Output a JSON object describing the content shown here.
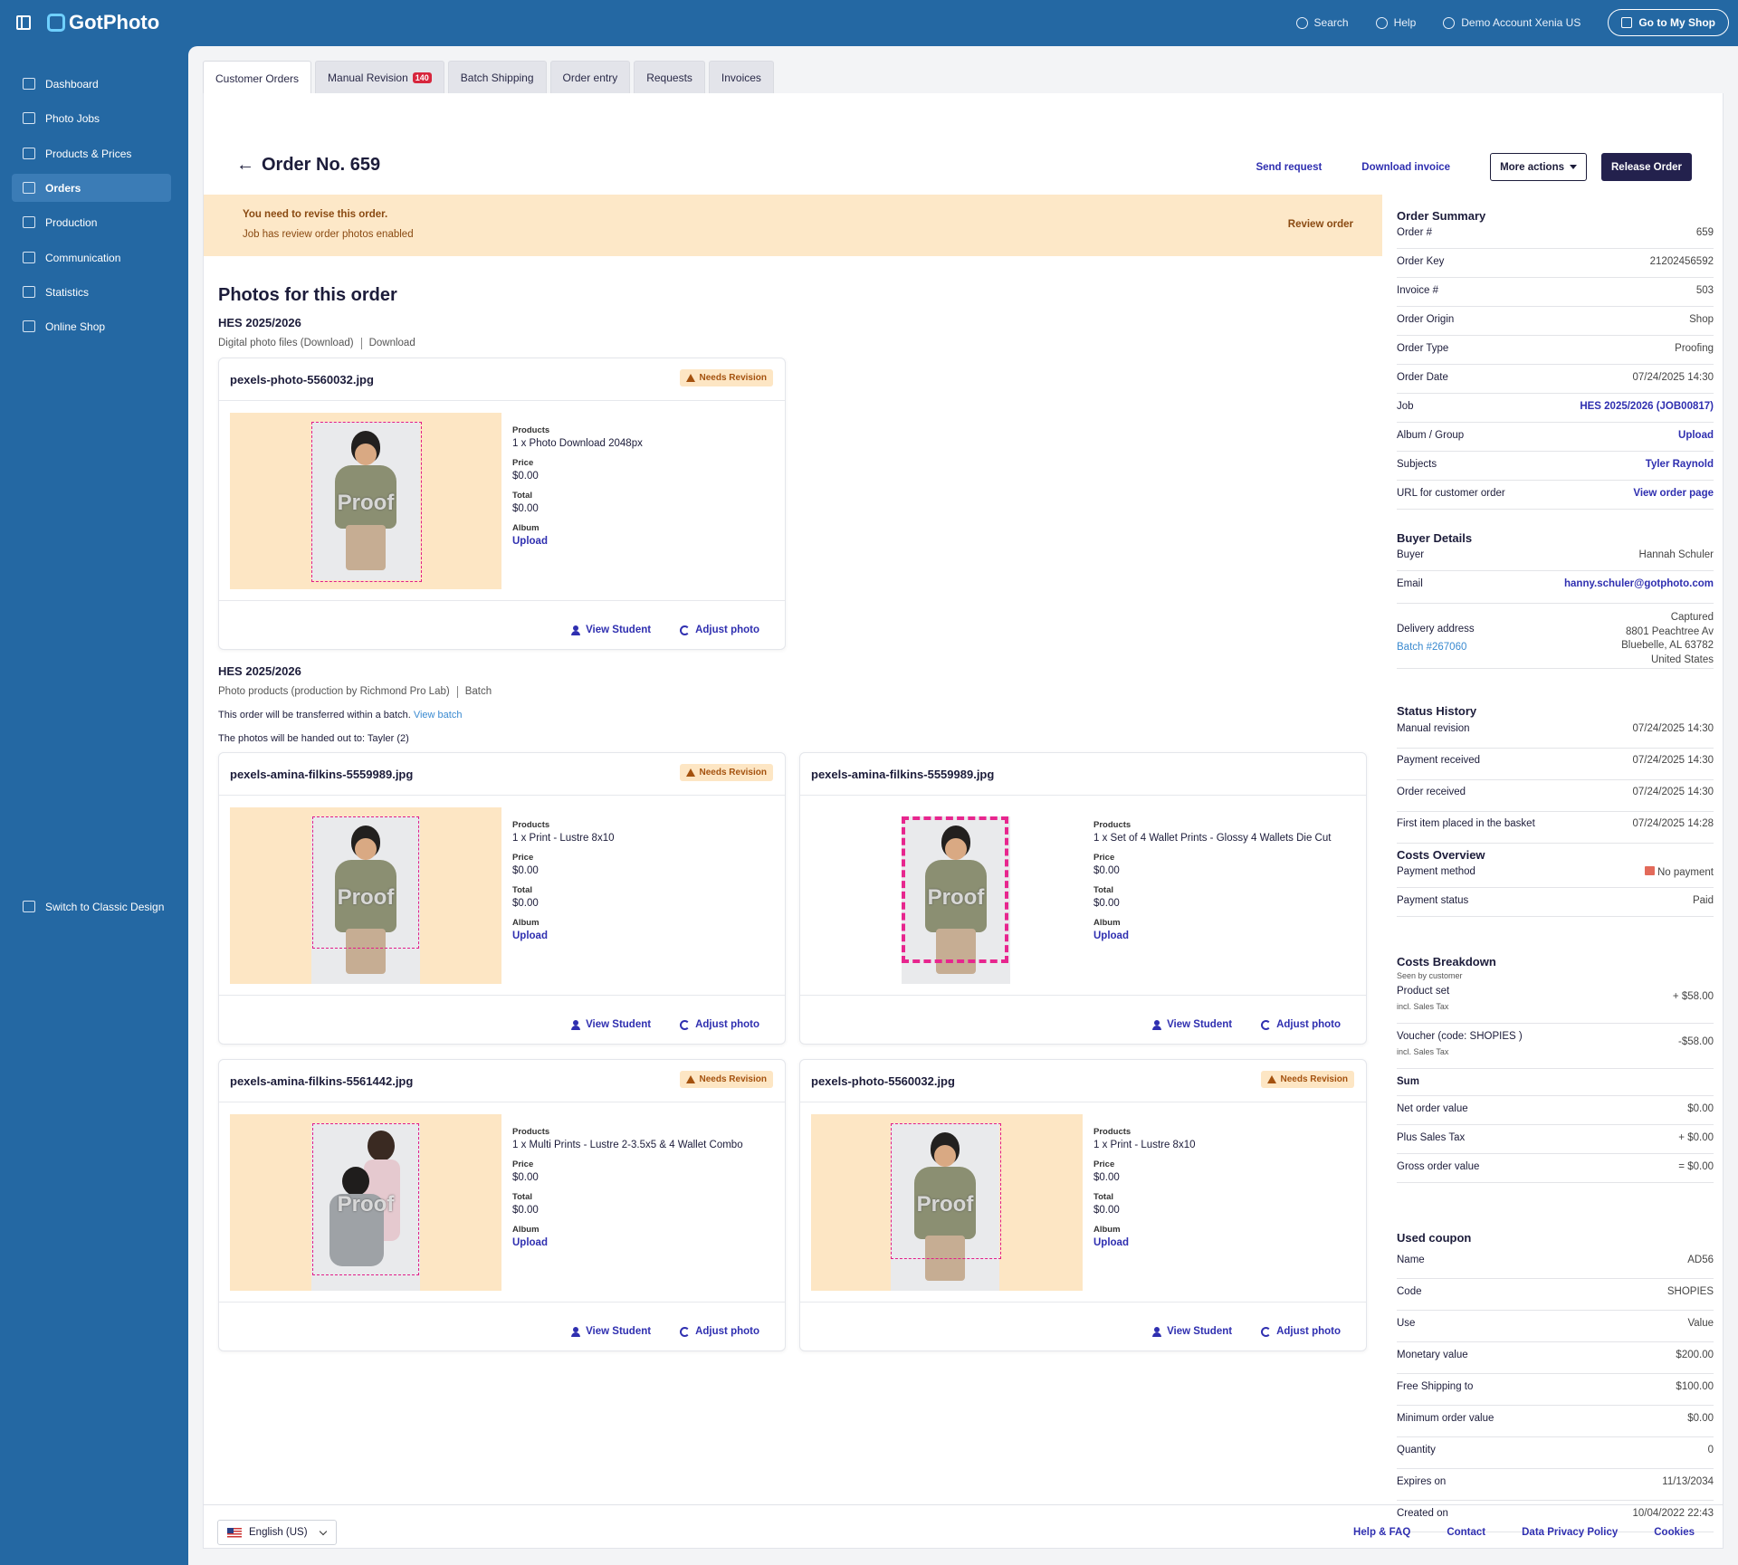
{
  "app": {
    "name": "GotPhoto"
  },
  "topbar": {
    "search": "Search",
    "help": "Help",
    "account": "Demo Account Xenia US",
    "shop_button": "Go to My Shop"
  },
  "sidebar": {
    "items": [
      {
        "label": "Dashboard",
        "icon": "home-icon"
      },
      {
        "label": "Photo Jobs",
        "icon": "camera-icon"
      },
      {
        "label": "Products & Prices",
        "icon": "cart-icon"
      },
      {
        "label": "Orders",
        "icon": "orders-icon",
        "active": true
      },
      {
        "label": "Production",
        "icon": "printer-icon"
      },
      {
        "label": "Communication",
        "icon": "chat-icon"
      },
      {
        "label": "Statistics",
        "icon": "chart-icon"
      },
      {
        "label": "Online Shop",
        "icon": "store-icon"
      }
    ],
    "classic": "Switch to Classic Design"
  },
  "tabs": [
    {
      "label": "Customer Orders",
      "active": true
    },
    {
      "label": "Manual Revision",
      "badge": "140"
    },
    {
      "label": "Batch Shipping"
    },
    {
      "label": "Order entry"
    },
    {
      "label": "Requests"
    },
    {
      "label": "Invoices"
    }
  ],
  "header": {
    "title": "Order No. 659",
    "send_request": "Send request",
    "download_invoice": "Download invoice",
    "more_actions": "More actions",
    "release": "Release Order"
  },
  "banner": {
    "line1": "You need to revise this order.",
    "line2": "Job has review order photos enabled",
    "action": "Review order"
  },
  "photos_title": "Photos for this order",
  "groups": [
    {
      "title": "HES 2025/2026",
      "sub1": "Digital photo files (Download)",
      "sub2": "Download"
    },
    {
      "title": "HES 2025/2026",
      "sub1": "Photo products (production by Richmond Pro Lab)",
      "sub2": "Batch",
      "note1": "This order will be transferred within a batch.",
      "note1_link": "View batch",
      "note2": "The photos will be handed out to: Tayler (2)"
    }
  ],
  "labels": {
    "products": "Products",
    "price": "Price",
    "total": "Total",
    "album": "Album",
    "needs_revision": "Needs Revision",
    "view_student": "View Student",
    "adjust_photo": "Adjust photo",
    "proof": "Proof"
  },
  "cards": [
    {
      "file": "pexels-photo-5560032.jpg",
      "needs_revision": true,
      "product": "1 x Photo Download 2048px",
      "price": "$0.00",
      "total": "$0.00",
      "album": "Upload"
    },
    {
      "file": "pexels-amina-filkins-5559989.jpg",
      "needs_revision": true,
      "product": "1 x Print - Lustre 8x10",
      "price": "$0.00",
      "total": "$0.00",
      "album": "Upload"
    },
    {
      "file": "pexels-amina-filkins-5559989.jpg",
      "needs_revision": false,
      "product": "1 x Set of 4 Wallet Prints - Glossy 4 Wallets Die Cut",
      "price": "$0.00",
      "total": "$0.00",
      "album": "Upload"
    },
    {
      "file": "pexels-amina-filkins-5561442.jpg",
      "needs_revision": true,
      "product": "1 x Multi Prints - Lustre 2-3.5x5 & 4 Wallet Combo",
      "price": "$0.00",
      "total": "$0.00",
      "album": "Upload"
    },
    {
      "file": "pexels-photo-5560032.jpg",
      "needs_revision": true,
      "product": "1 x Print - Lustre 8x10",
      "price": "$0.00",
      "total": "$0.00",
      "album": "Upload"
    }
  ],
  "summary": {
    "title": "Order Summary",
    "rows": [
      {
        "k": "Order #",
        "v": "659"
      },
      {
        "k": "Order Key",
        "v": "21202456592"
      },
      {
        "k": "Invoice #",
        "v": "503"
      },
      {
        "k": "Order Origin",
        "v": "Shop"
      },
      {
        "k": "Order Type",
        "v": "Proofing"
      },
      {
        "k": "Order Date",
        "v": "07/24/2025 14:30"
      },
      {
        "k": "Job",
        "v": "HES 2025/2026 (JOB00817)",
        "link": true
      },
      {
        "k": "Album / Group",
        "v": "Upload",
        "link": true
      },
      {
        "k": "Subjects",
        "v": "Tyler Raynold",
        "link": true
      },
      {
        "k": "URL for customer order",
        "v": "View order page",
        "link": true
      }
    ]
  },
  "buyer": {
    "title": "Buyer Details",
    "buyer_k": "Buyer",
    "buyer_v": "Hannah Schuler",
    "email_k": "Email",
    "email_v": "hanny.schuler@gotphoto.com",
    "delivery_k": "Delivery address",
    "batch_link": "Batch #267060",
    "addr": [
      "Captured",
      "8801 Peachtree Av",
      "Bluebelle, AL 63782",
      "United States"
    ]
  },
  "status": {
    "title": "Status History",
    "rows": [
      {
        "k": "Manual revision",
        "v": "07/24/2025 14:30"
      },
      {
        "k": "Payment received",
        "v": "07/24/2025 14:30"
      },
      {
        "k": "Order received",
        "v": "07/24/2025 14:30"
      },
      {
        "k": "First item placed in the basket",
        "v": "07/24/2025 14:28"
      }
    ]
  },
  "costs": {
    "title": "Costs Overview",
    "rows": [
      {
        "k": "Payment method",
        "v": "No payment"
      },
      {
        "k": "Payment status",
        "v": "Paid"
      }
    ]
  },
  "breakdown": {
    "title": "Costs Breakdown",
    "sub": "Seen by customer",
    "product_k": "Product set",
    "product_small": "incl. Sales Tax",
    "product_v": "+ $58.00",
    "voucher_k": "Voucher (code: SHOPIES )",
    "voucher_small": "incl. Sales Tax",
    "voucher_v": "-$58.00",
    "sum": "Sum",
    "rows": [
      {
        "k": "Net order value",
        "v": "$0.00"
      },
      {
        "k": "Plus Sales Tax",
        "v": "+ $0.00"
      },
      {
        "k": "Gross order value",
        "v": "= $0.00"
      }
    ]
  },
  "coupon": {
    "title": "Used coupon",
    "rows": [
      {
        "k": "Name",
        "v": "AD56"
      },
      {
        "k": "Code",
        "v": "SHOPIES"
      },
      {
        "k": "Use",
        "v": "Value"
      },
      {
        "k": "Monetary value",
        "v": "$200.00"
      },
      {
        "k": "Free Shipping to",
        "v": "$100.00"
      },
      {
        "k": "Minimum order value",
        "v": "$0.00"
      },
      {
        "k": "Quantity",
        "v": "0"
      },
      {
        "k": "Expires on",
        "v": "11/13/2034"
      },
      {
        "k": "Created on",
        "v": "10/04/2022 22:43"
      }
    ]
  },
  "footer": {
    "language": "English (US)",
    "links": [
      "Help & FAQ",
      "Contact",
      "Data Privacy Policy",
      "Cookies"
    ]
  }
}
